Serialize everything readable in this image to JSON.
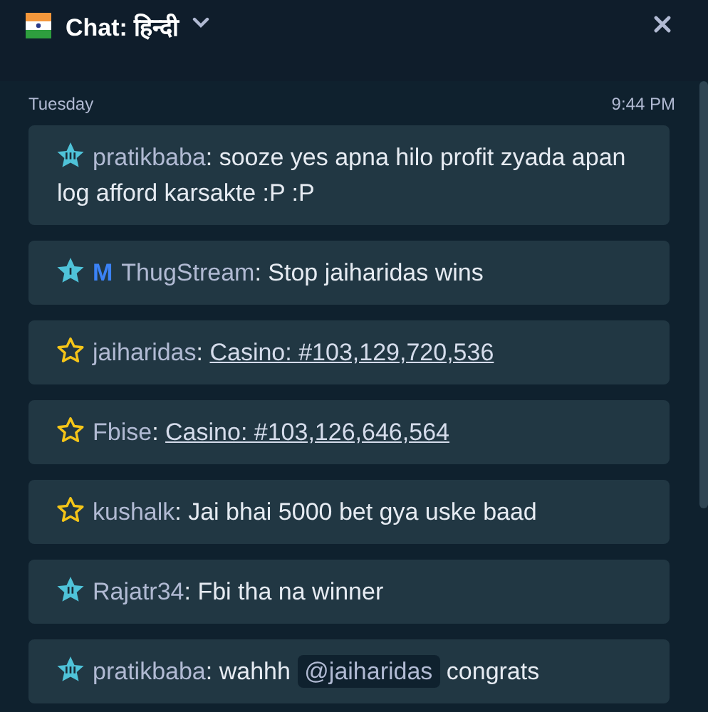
{
  "header": {
    "title": "Chat: हिन्दी"
  },
  "day": {
    "label": "Tuesday",
    "time": "9:44 PM"
  },
  "messages": [
    {
      "kind": "vip3",
      "user": "pratikbaba",
      "parts": [
        {
          "kind": "text",
          "text": ": sooze yes apna hilo profit zyada apan log afford karsakte :P :P"
        }
      ]
    },
    {
      "kind": "vip1",
      "tag": "M",
      "user": "ThugStream",
      "parts": [
        {
          "kind": "text",
          "text": ": Stop jaiharidas wins"
        }
      ]
    },
    {
      "kind": "bronze",
      "user": "jaiharidas",
      "parts": [
        {
          "kind": "text",
          "text": ": "
        },
        {
          "kind": "link",
          "text": "Casino: #103,129,720,536"
        }
      ]
    },
    {
      "kind": "bronze",
      "user": "Fbise",
      "parts": [
        {
          "kind": "text",
          "text": ": "
        },
        {
          "kind": "link",
          "text": "Casino: #103,126,646,564"
        }
      ]
    },
    {
      "kind": "bronze",
      "user": "kushalk",
      "parts": [
        {
          "kind": "text",
          "text": ": Jai bhai 5000 bet gya uske baad"
        }
      ]
    },
    {
      "kind": "vip2",
      "user": "Rajatr34",
      "parts": [
        {
          "kind": "text",
          "text": ": Fbi tha na winner"
        }
      ]
    },
    {
      "kind": "vip3",
      "user": "pratikbaba",
      "parts": [
        {
          "kind": "text",
          "text": ": wahhh "
        },
        {
          "kind": "mention",
          "text": "@jaiharidas"
        },
        {
          "kind": "text",
          "text": " congrats"
        }
      ]
    }
  ]
}
